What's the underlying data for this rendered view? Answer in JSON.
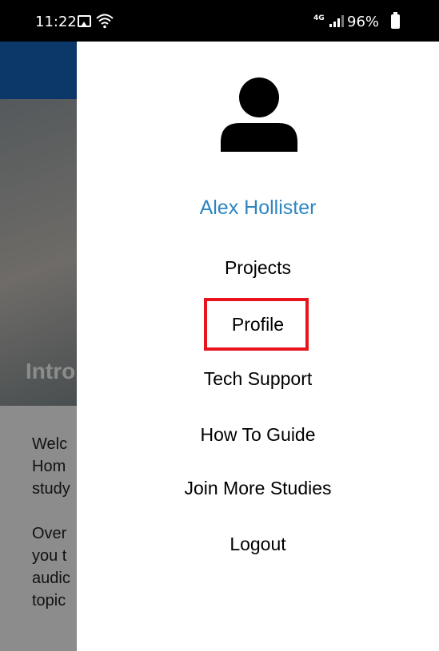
{
  "status_bar": {
    "time": "11:22",
    "network": "4G",
    "battery": "96%",
    "icons": [
      "gallery-icon",
      "wifi-icon",
      "lte-icon",
      "signal-icon",
      "battery-icon"
    ]
  },
  "background": {
    "hero_title": "Intro",
    "body_paragraphs": [
      "Welc\nHom\nstudy",
      "Over\nyou t\naudic\ntopic"
    ],
    "header_color": "#1565c0"
  },
  "drawer": {
    "user_name": "Alex Hollister",
    "avatar_icon": "person-icon",
    "menu": {
      "projects": "Projects",
      "profile": "Profile",
      "tech_support": "Tech Support",
      "how_to_guide": "How To Guide",
      "join_more_studies": "Join More Studies",
      "logout": "Logout"
    },
    "accent_color": "#2e86c1",
    "highlight_color": "#e8141c"
  }
}
